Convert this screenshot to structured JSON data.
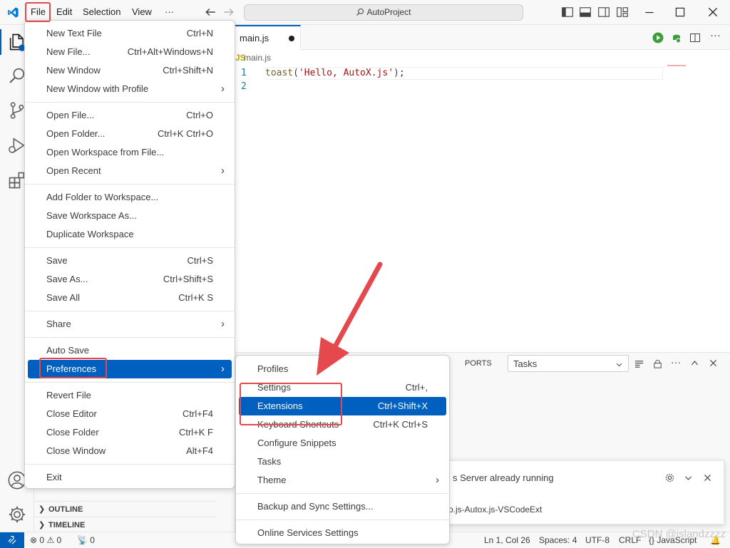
{
  "titlebar": {
    "menus": [
      "File",
      "Edit",
      "Selection",
      "View",
      "···"
    ],
    "search_text": "AutoProject"
  },
  "editor": {
    "tab_label": "main.js",
    "breadcrumb": "main.js",
    "lines": [
      {
        "num": "1",
        "text": "toast('Hello, AutoX.js');"
      },
      {
        "num": "2",
        "text": ""
      }
    ]
  },
  "sidebar": {
    "outline": "OUTLINE",
    "timeline": "TIMELINE"
  },
  "panel": {
    "tab_ports": "PORTS",
    "tasks_select": "Tasks"
  },
  "notification": {
    "message": "s Server already running",
    "source": "o.js-Autox.js-VSCodeExt"
  },
  "file_menu": {
    "groups": [
      [
        {
          "label": "New Text File",
          "key": "Ctrl+N"
        },
        {
          "label": "New File...",
          "key": "Ctrl+Alt+Windows+N"
        },
        {
          "label": "New Window",
          "key": "Ctrl+Shift+N"
        },
        {
          "label": "New Window with Profile",
          "key": "",
          "submenu": true
        }
      ],
      [
        {
          "label": "Open File...",
          "key": "Ctrl+O"
        },
        {
          "label": "Open Folder...",
          "key": "Ctrl+K Ctrl+O"
        },
        {
          "label": "Open Workspace from File...",
          "key": ""
        },
        {
          "label": "Open Recent",
          "key": "",
          "submenu": true
        }
      ],
      [
        {
          "label": "Add Folder to Workspace...",
          "key": ""
        },
        {
          "label": "Save Workspace As...",
          "key": ""
        },
        {
          "label": "Duplicate Workspace",
          "key": ""
        }
      ],
      [
        {
          "label": "Save",
          "key": "Ctrl+S"
        },
        {
          "label": "Save As...",
          "key": "Ctrl+Shift+S"
        },
        {
          "label": "Save All",
          "key": "Ctrl+K S"
        }
      ],
      [
        {
          "label": "Share",
          "key": "",
          "submenu": true
        }
      ],
      [
        {
          "label": "Auto Save",
          "key": ""
        },
        {
          "label": "Preferences",
          "key": "",
          "submenu": true,
          "selected": true
        }
      ],
      [
        {
          "label": "Revert File",
          "key": ""
        },
        {
          "label": "Close Editor",
          "key": "Ctrl+F4"
        },
        {
          "label": "Close Folder",
          "key": "Ctrl+K F"
        },
        {
          "label": "Close Window",
          "key": "Alt+F4"
        }
      ],
      [
        {
          "label": "Exit",
          "key": ""
        }
      ]
    ]
  },
  "preferences_menu": {
    "groups": [
      [
        {
          "label": "Profiles",
          "key": ""
        },
        {
          "label": "Settings",
          "key": "Ctrl+,"
        },
        {
          "label": "Extensions",
          "key": "Ctrl+Shift+X",
          "selected": true
        },
        {
          "label": "Keyboard Shortcuts",
          "key": "Ctrl+K Ctrl+S"
        },
        {
          "label": "Configure Snippets",
          "key": ""
        },
        {
          "label": "Tasks",
          "key": ""
        },
        {
          "label": "Theme",
          "key": "",
          "submenu": true
        }
      ],
      [
        {
          "label": "Backup and Sync Settings...",
          "key": ""
        }
      ],
      [
        {
          "label": "Online Services Settings",
          "key": ""
        }
      ]
    ]
  },
  "statusbar": {
    "errors": "0",
    "warnings": "0",
    "ports": "0",
    "position": "Ln 1, Col 26",
    "spaces": "Spaces: 4",
    "encoding": "UTF-8",
    "eol": "CRLF",
    "language": "JavaScript"
  },
  "watermark": "CSDN @islandzzzz",
  "colors": {
    "accent": "#005fb8",
    "selection": "#0060c0",
    "annotation_red": "#e5484d",
    "string": "#a31515",
    "function": "#795e26"
  }
}
